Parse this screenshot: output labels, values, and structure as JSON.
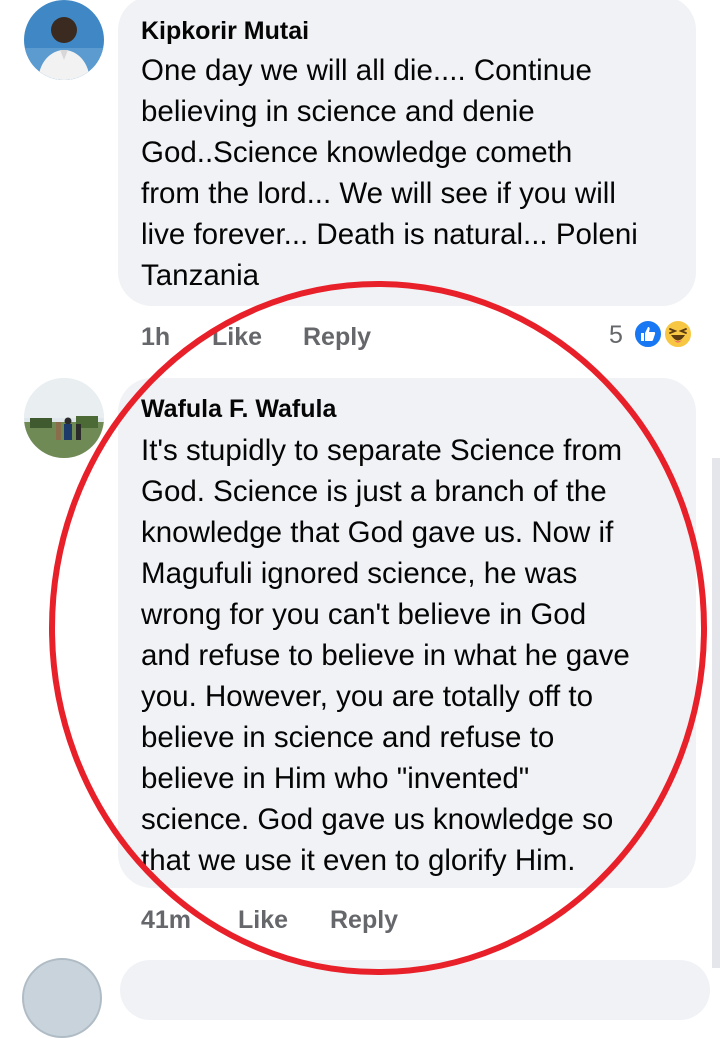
{
  "comments": [
    {
      "author": "Kipkorir Mutai",
      "lines": [
        "One day we will all die.... Continue",
        "believing in science and denie",
        "God..Science knowledge cometh",
        "from the lord... We will see if you will",
        "live forever... Death is natural... Poleni",
        "Tanzania"
      ],
      "time": "1h",
      "like_label": "Like",
      "reply_label": "Reply",
      "reaction_count": "5",
      "reactions": [
        "like-icon",
        "haha-icon"
      ]
    },
    {
      "author": "Wafula F. Wafula",
      "lines": [
        "It's stupidly to separate Science from",
        "God. Science is just a branch of the",
        "knowledge that God gave us. Now if",
        "Magufuli ignored science, he was",
        "wrong for you can't believe in God",
        "and refuse to believe in what he gave",
        "you. However, you are totally off to",
        "believe in science and refuse to",
        "believe in Him who \"invented\"",
        "science. God gave us knowledge so",
        "that we use it even to glorify Him."
      ],
      "time": "41m",
      "like_label": "Like",
      "reply_label": "Reply"
    }
  ],
  "colors": {
    "bubble": "#f0f2f5",
    "meta_text": "#65676b",
    "like_blue": "#1877f2",
    "annotation_red": "#e8202a"
  }
}
